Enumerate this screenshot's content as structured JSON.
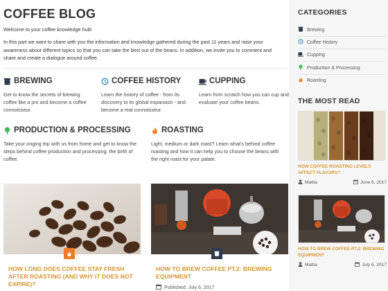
{
  "blog": {
    "title": "COFFEE BLOG",
    "welcome": "Welcome to your coffee knowledge hub!",
    "intro": "In this part we want to share with you the information and knowledge gathered during the past 11 years and raise your awareness about different topics so that you can take the best out of the beans. In addition, we invite you to comment and share and create a dialogue around coffee."
  },
  "categories": [
    {
      "title": "BREWING",
      "icon": "kettle-icon",
      "desc": "Get to know the secrets of brewing coffee like a pro and become a coffee connoisseur."
    },
    {
      "title": "COFFEE HISTORY",
      "icon": "history-icon",
      "desc": "Learn the history of coffee - from its discovery to its global expansion - and become a real connoisseur."
    },
    {
      "title": "CUPPING",
      "icon": "cup-icon",
      "desc": "Learn from scratch how you can cup and evaluate your coffee beans."
    },
    {
      "title": "PRODUCTION & PROCESSING",
      "icon": "plant-icon",
      "desc": "Take your origing trip with us from home and get to know the steps behind coffee production and processing: the birth of coffee."
    },
    {
      "title": "ROASTING",
      "icon": "flame-icon",
      "desc": "Light, medium or dark roast? Learn what's behind coffee roasting and how it can help you to choose the beans with the right roast for your palate."
    }
  ],
  "posts": [
    {
      "title": "HOW LONG DOES COFFEE STAY FRESH AFTER ROASTING (AND WHY IT DOES NOT EXPIRE)?",
      "badge_icon": "flame-icon"
    },
    {
      "title": "HOW TO BREW COFFEE PT.2: BREWING EQUIPMENT",
      "badge_icon": "kettle-icon",
      "meta": "Published: July 6, 2017"
    }
  ],
  "sidebar": {
    "categories_heading": "CATEGORIES",
    "items": [
      {
        "label": "Brewing",
        "icon": "kettle-icon"
      },
      {
        "label": "Coffee History",
        "icon": "history-icon"
      },
      {
        "label": "Cupping",
        "icon": "cup-icon"
      },
      {
        "label": "Production & Processing",
        "icon": "plant-icon"
      },
      {
        "label": "Roasting",
        "icon": "flame-icon"
      }
    ],
    "most_read_heading": "THE MOST READ",
    "most_read": [
      {
        "title": "HOW COFFEE ROASTING LEVELS AFFECT FLAVORS?",
        "author": "Mattia",
        "date": "June 6, 2017"
      },
      {
        "title": "HOW TO BREW COFFEE PT.2: BREWING EQUIPMENT",
        "author": "Mattia",
        "date": "July 6, 2017"
      }
    ]
  },
  "colors": {
    "accent": "#d6952f",
    "history_blue": "#3a8fc6",
    "plant_green": "#3dbb5a",
    "flame_orange": "#ef7d2b",
    "dark_icon": "#2f3b4c"
  }
}
